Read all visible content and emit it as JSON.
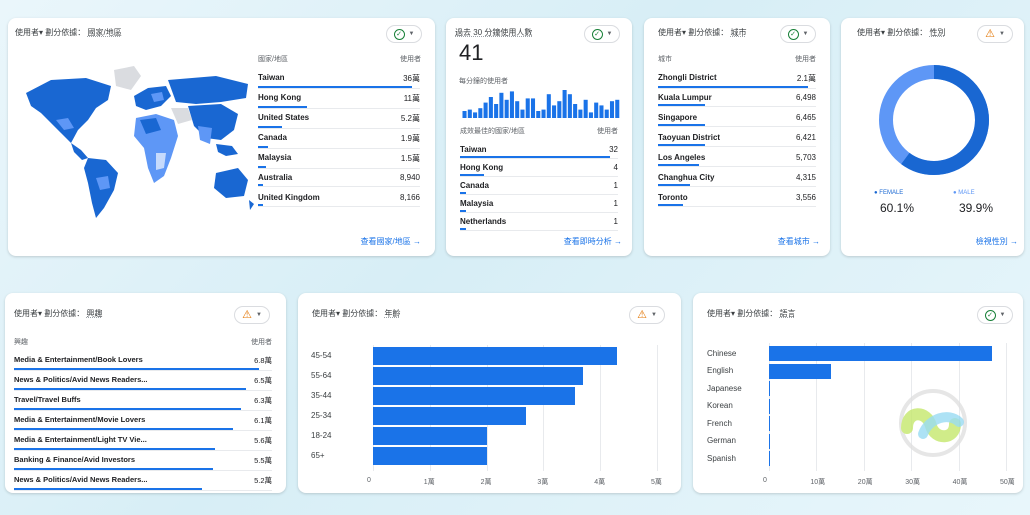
{
  "labels": {
    "users": "使用者",
    "breakdown": "劃分依據：",
    "dropdown_caret": "▾"
  },
  "country_card": {
    "dimension": "國家/地區",
    "col_name": "國家/地區",
    "col_value": "使用者",
    "rows": [
      {
        "name": "Taiwan",
        "value": "36萬",
        "share": 0.95
      },
      {
        "name": "Hong Kong",
        "value": "11萬",
        "share": 0.3
      },
      {
        "name": "United States",
        "value": "5.2萬",
        "share": 0.15
      },
      {
        "name": "Canada",
        "value": "1.9萬",
        "share": 0.06
      },
      {
        "name": "Malaysia",
        "value": "1.5萬",
        "share": 0.05
      },
      {
        "name": "Australia",
        "value": "8,940",
        "share": 0.03
      },
      {
        "name": "United Kingdom",
        "value": "8,166",
        "share": 0.03
      }
    ],
    "link": "查看國家/地區 →"
  },
  "realtime_card": {
    "title": "過去 30 分鐘使用人數",
    "count": "41",
    "per_minute_label": "每分鐘的使用者",
    "per_minute_bars": [
      0.25,
      0.3,
      0.2,
      0.35,
      0.55,
      0.75,
      0.5,
      0.9,
      0.65,
      0.95,
      0.6,
      0.3,
      0.7,
      0.7,
      0.25,
      0.3,
      0.85,
      0.45,
      0.6,
      1.0,
      0.85,
      0.5,
      0.3,
      0.65,
      0.2,
      0.55,
      0.45,
      0.3,
      0.6,
      0.65
    ],
    "col_name": "成效最佳的國家/地區",
    "col_value": "使用者",
    "rows": [
      {
        "name": "Taiwan",
        "value": "32",
        "share": 0.95
      },
      {
        "name": "Hong Kong",
        "value": "4",
        "share": 0.15
      },
      {
        "name": "Canada",
        "value": "1",
        "share": 0.04
      },
      {
        "name": "Malaysia",
        "value": "1",
        "share": 0.04
      },
      {
        "name": "Netherlands",
        "value": "1",
        "share": 0.04
      }
    ],
    "link": "查看即時分析 →"
  },
  "city_card": {
    "dimension": "城市",
    "col_name": "城市",
    "col_value": "使用者",
    "rows": [
      {
        "name": "Zhongli District",
        "value": "2.1萬",
        "share": 0.95
      },
      {
        "name": "Kuala Lumpur",
        "value": "6,498",
        "share": 0.3
      },
      {
        "name": "Singapore",
        "value": "6,465",
        "share": 0.3
      },
      {
        "name": "Taoyuan District",
        "value": "6,421",
        "share": 0.3
      },
      {
        "name": "Los Angeles",
        "value": "5,703",
        "share": 0.26
      },
      {
        "name": "Changhua City",
        "value": "4,315",
        "share": 0.2
      },
      {
        "name": "Toronto",
        "value": "3,556",
        "share": 0.16
      }
    ],
    "link": "查看城市 →"
  },
  "gender_card": {
    "dimension": "性別",
    "female_label": "● FEMALE",
    "female_value": "60.1%",
    "male_label": "● MALE",
    "male_value": "39.9%",
    "female_share": 0.601,
    "link": "檢視性別 →"
  },
  "interest_card": {
    "dimension": "興趣",
    "col_name": "興趣",
    "col_value": "使用者",
    "rows": [
      {
        "name": "Media & Entertainment/Book Lovers",
        "value": "6.8萬",
        "share": 0.95
      },
      {
        "name": "News & Politics/Avid News Readers...",
        "value": "6.5萬",
        "share": 0.9
      },
      {
        "name": "Travel/Travel Buffs",
        "value": "6.3萬",
        "share": 0.88
      },
      {
        "name": "Media & Entertainment/Movie Lovers",
        "value": "6.1萬",
        "share": 0.85
      },
      {
        "name": "Media & Entertainment/Light TV Vie...",
        "value": "5.6萬",
        "share": 0.78
      },
      {
        "name": "Banking & Finance/Avid Investors",
        "value": "5.5萬",
        "share": 0.77
      },
      {
        "name": "News & Politics/Avid News Readers...",
        "value": "5.2萬",
        "share": 0.73
      }
    ]
  },
  "age_card": {
    "dimension": "年齡",
    "chart_data": {
      "type": "bar",
      "orientation": "horizontal",
      "categories": [
        "45-54",
        "55-64",
        "35-44",
        "25-34",
        "18-24",
        "65+"
      ],
      "values": [
        4.3,
        3.7,
        3.55,
        2.7,
        2.0,
        2.0
      ],
      "xticks": [
        "0",
        "1萬",
        "2萬",
        "3萬",
        "4萬",
        "5萬"
      ],
      "xlim": [
        0,
        5
      ]
    }
  },
  "language_card": {
    "dimension": "語言",
    "chart_data": {
      "type": "bar",
      "orientation": "horizontal",
      "categories": [
        "Chinese",
        "English",
        "Japanese",
        "Korean",
        "French",
        "German",
        "Spanish"
      ],
      "values": [
        47,
        13,
        0.2,
        0.1,
        0.1,
        0.1,
        0.1
      ],
      "xticks": [
        "0",
        "10萬",
        "20萬",
        "30萬",
        "40萬",
        "50萬"
      ],
      "xlim": [
        0,
        50
      ]
    }
  },
  "colors": {
    "accent": "#1a73e8",
    "map_dark": "#1967d2",
    "map_mid": "#5e97f6",
    "map_light": "#c6dafc",
    "map_gray": "#dadce0",
    "ok": "#188038",
    "warn": "#e37400"
  }
}
